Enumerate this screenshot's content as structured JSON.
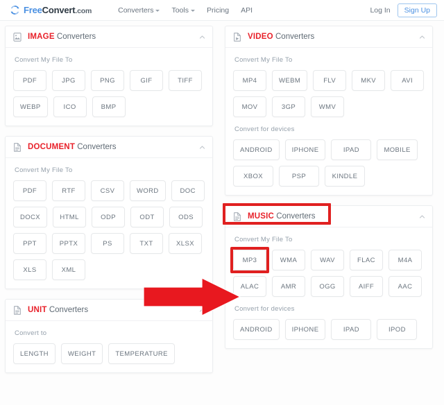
{
  "header": {
    "logo": {
      "part1": "Free",
      "part2": "Convert",
      "part3": ".com",
      "icon": "refresh-circle-icon"
    },
    "nav": [
      {
        "label": "Converters",
        "has_caret": true
      },
      {
        "label": "Tools",
        "has_caret": true
      },
      {
        "label": "Pricing",
        "has_caret": false
      },
      {
        "label": "API",
        "has_caret": false
      }
    ],
    "login_label": "Log In",
    "signup_label": "Sign Up"
  },
  "colors": {
    "brand_blue": "#4a90e2",
    "category_red": "#e8212a",
    "highlight_red": "#e02020",
    "button_text": "#6b757f",
    "label_gray": "#95a0ab"
  },
  "annotations": {
    "arrow": {
      "shape": "right-block-arrow",
      "color": "#e8181f",
      "points_to": "MP3"
    },
    "highlight_boxes": [
      "MUSIC Converters",
      "MP3"
    ]
  },
  "panels": {
    "image": {
      "category": "IMAGE",
      "word": "Converters",
      "icon": "image-file-icon",
      "collapse_icon": "chevron-up-icon",
      "sections": [
        {
          "label": "Convert My File To",
          "buttons": [
            "PDF",
            "JPG",
            "PNG",
            "GIF",
            "TIFF",
            "WEBP",
            "ICO",
            "BMP"
          ]
        }
      ]
    },
    "document": {
      "category": "DOCUMENT",
      "word": "Converters",
      "icon": "document-file-icon",
      "collapse_icon": "chevron-up-icon",
      "sections": [
        {
          "label": "Convert My File To",
          "buttons": [
            "PDF",
            "RTF",
            "CSV",
            "WORD",
            "DOC",
            "DOCX",
            "HTML",
            "ODP",
            "ODT",
            "ODS",
            "PPT",
            "PPTX",
            "PS",
            "TXT",
            "XLSX",
            "XLS",
            "XML"
          ]
        }
      ]
    },
    "unit": {
      "category": "UNIT",
      "word": "Converters",
      "icon": "document-file-icon",
      "collapse_icon": "chevron-up-icon",
      "sections": [
        {
          "label": "Convert to",
          "buttons": [
            "LENGTH",
            "WEIGHT",
            "TEMPERATURE"
          ]
        }
      ]
    },
    "video": {
      "category": "VIDEO",
      "word": "Converters",
      "icon": "video-file-icon",
      "collapse_icon": "chevron-up-icon",
      "sections": [
        {
          "label": "Convert My File To",
          "buttons": [
            "MP4",
            "WEBM",
            "FLV",
            "MKV",
            "AVI",
            "MOV",
            "3GP",
            "WMV"
          ]
        },
        {
          "label": "Convert for devices",
          "buttons": [
            "ANDROID",
            "IPHONE",
            "IPAD",
            "MOBILE",
            "XBOX",
            "PSP",
            "KINDLE"
          ]
        }
      ]
    },
    "music": {
      "category": "MUSIC",
      "word": "Converters",
      "icon": "document-file-icon",
      "collapse_icon": "chevron-up-icon",
      "highlighted": true,
      "sections": [
        {
          "label": "Convert My File To",
          "buttons": [
            "MP3",
            "WMA",
            "WAV",
            "FLAC",
            "M4A",
            "ALAC",
            "AMR",
            "OGG",
            "AIFF",
            "AAC"
          ],
          "highlighted_button": "MP3"
        },
        {
          "label": "Convert for devices",
          "buttons": [
            "ANDROID",
            "IPHONE",
            "IPAD",
            "IPOD"
          ]
        }
      ]
    }
  }
}
